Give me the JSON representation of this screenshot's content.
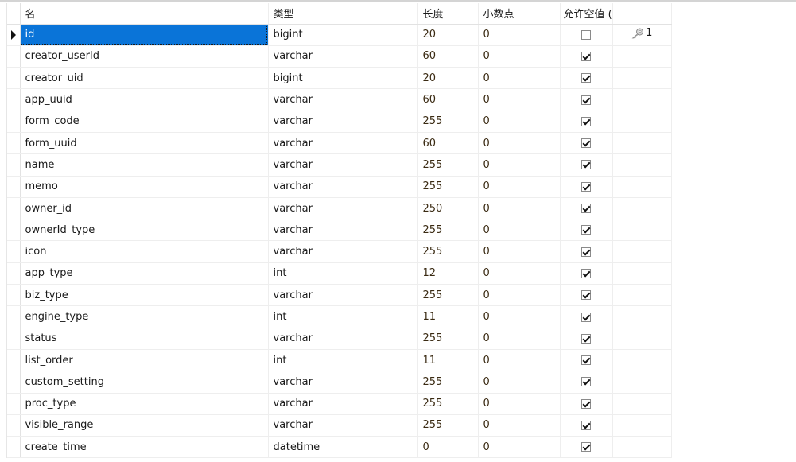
{
  "table_designer": {
    "columns": {
      "name": "名",
      "type": "类型",
      "length": "长度",
      "decimals": "小数点",
      "nullable": "允许空值 (",
      "key": ""
    },
    "selected_row": 0,
    "rows": [
      {
        "name": "id",
        "type": "bigint",
        "length": "20",
        "decimals": "0",
        "nullable": false,
        "key_icon": "primary-key-icon",
        "key": "1"
      },
      {
        "name": "creator_userId",
        "type": "varchar",
        "length": "60",
        "decimals": "0",
        "nullable": true,
        "key": ""
      },
      {
        "name": "creator_uid",
        "type": "bigint",
        "length": "20",
        "decimals": "0",
        "nullable": true,
        "key": ""
      },
      {
        "name": "app_uuid",
        "type": "varchar",
        "length": "60",
        "decimals": "0",
        "nullable": true,
        "key": ""
      },
      {
        "name": "form_code",
        "type": "varchar",
        "length": "255",
        "decimals": "0",
        "nullable": true,
        "key": ""
      },
      {
        "name": "form_uuid",
        "type": "varchar",
        "length": "60",
        "decimals": "0",
        "nullable": true,
        "key": ""
      },
      {
        "name": "name",
        "type": "varchar",
        "length": "255",
        "decimals": "0",
        "nullable": true,
        "key": ""
      },
      {
        "name": "memo",
        "type": "varchar",
        "length": "255",
        "decimals": "0",
        "nullable": true,
        "key": ""
      },
      {
        "name": "owner_id",
        "type": "varchar",
        "length": "250",
        "decimals": "0",
        "nullable": true,
        "key": ""
      },
      {
        "name": "ownerId_type",
        "type": "varchar",
        "length": "255",
        "decimals": "0",
        "nullable": true,
        "key": ""
      },
      {
        "name": "icon",
        "type": "varchar",
        "length": "255",
        "decimals": "0",
        "nullable": true,
        "key": ""
      },
      {
        "name": "app_type",
        "type": "int",
        "length": "12",
        "decimals": "0",
        "nullable": true,
        "key": ""
      },
      {
        "name": "biz_type",
        "type": "varchar",
        "length": "255",
        "decimals": "0",
        "nullable": true,
        "key": ""
      },
      {
        "name": "engine_type",
        "type": "int",
        "length": "11",
        "decimals": "0",
        "nullable": true,
        "key": ""
      },
      {
        "name": "status",
        "type": "varchar",
        "length": "255",
        "decimals": "0",
        "nullable": true,
        "key": ""
      },
      {
        "name": "list_order",
        "type": "int",
        "length": "11",
        "decimals": "0",
        "nullable": true,
        "key": ""
      },
      {
        "name": "custom_setting",
        "type": "varchar",
        "length": "255",
        "decimals": "0",
        "nullable": true,
        "key": ""
      },
      {
        "name": "proc_type",
        "type": "varchar",
        "length": "255",
        "decimals": "0",
        "nullable": true,
        "key": ""
      },
      {
        "name": "visible_range",
        "type": "varchar",
        "length": "255",
        "decimals": "0",
        "nullable": true,
        "key": ""
      },
      {
        "name": "create_time",
        "type": "datetime",
        "length": "0",
        "decimals": "0",
        "nullable": true,
        "key": ""
      }
    ]
  }
}
